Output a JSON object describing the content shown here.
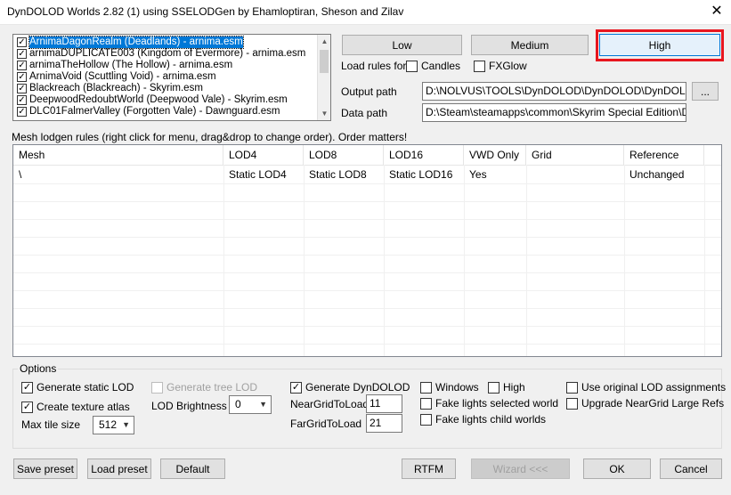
{
  "window": {
    "title": "DynDOLOD Worlds 2.82 (1) using SSELODGen by Ehamloptiran, Sheson and Zilav",
    "close_glyph": "✕"
  },
  "worlds": [
    {
      "label": "ArnimaDagonRealm (Deadlands) - arnima.esm",
      "checked": true,
      "selected": true
    },
    {
      "label": "arnimaDUPLICATE003 (Kingdom of Evermore) - arnima.esm",
      "checked": true
    },
    {
      "label": "arnimaTheHollow (The Hollow) - arnima.esm",
      "checked": true
    },
    {
      "label": "ArnimaVoid (Scuttling Void) - arnima.esm",
      "checked": true
    },
    {
      "label": "Blackreach (Blackreach) - Skyrim.esm",
      "checked": true
    },
    {
      "label": "DeepwoodRedoubtWorld (Deepwood Vale) - Skyrim.esm",
      "checked": true
    },
    {
      "label": "DLC01FalmerValley (Forgotten Vale) - Dawnguard.esm",
      "checked": true
    }
  ],
  "presets": {
    "low": "Low",
    "medium": "Medium",
    "high": "High"
  },
  "load_rules": {
    "label": "Load rules for",
    "candles": "Candles",
    "fxglow": "FXGlow"
  },
  "paths": {
    "output_label": "Output path",
    "output_value": "D:\\NOLVUS\\TOOLS\\DynDOLOD\\DynDOLOD\\DynDOLOD_Output",
    "browse_label": "...",
    "data_label": "Data path",
    "data_value": "D:\\Steam\\steamapps\\common\\Skyrim Special Edition\\Data\\"
  },
  "rules": {
    "caption": "Mesh lodgen rules (right click for menu, drag&drop to change order). Order matters!",
    "columns": [
      "Mesh",
      "LOD4",
      "LOD8",
      "LOD16",
      "VWD Only",
      "Grid",
      "Reference"
    ],
    "rows": [
      [
        "\\",
        "Static LOD4",
        "Static LOD8",
        "Static LOD16",
        "Yes",
        "",
        "Unchanged"
      ]
    ]
  },
  "options": {
    "legend": "Options",
    "generate_static_lod": "Generate static LOD",
    "create_texture_atlas": "Create texture atlas",
    "max_tile_size_label": "Max tile size",
    "max_tile_size_value": "512",
    "generate_tree_lod": "Generate tree LOD",
    "lod_brightness_label": "LOD Brightness",
    "lod_brightness_value": "0",
    "generate_dyndolod": "Generate DynDOLOD",
    "near_grid_label": "NearGridToLoad",
    "near_grid_value": "11",
    "far_grid_label": "FarGridToLoad",
    "far_grid_value": "21",
    "windows": "Windows",
    "high": "High",
    "fake_lights_selected": "Fake lights selected world",
    "fake_lights_child": "Fake lights child worlds",
    "use_original_lod": "Use original LOD assignments",
    "upgrade_neargrid": "Upgrade NearGrid Large Refs"
  },
  "footer": {
    "save_preset": "Save preset",
    "load_preset": "Load preset",
    "default": "Default",
    "rtfm": "RTFM",
    "wizard": "Wizard <<<",
    "ok": "OK",
    "cancel": "Cancel"
  },
  "colors": {
    "highlight_box": "#e8161f",
    "selection": "#0078d7"
  }
}
